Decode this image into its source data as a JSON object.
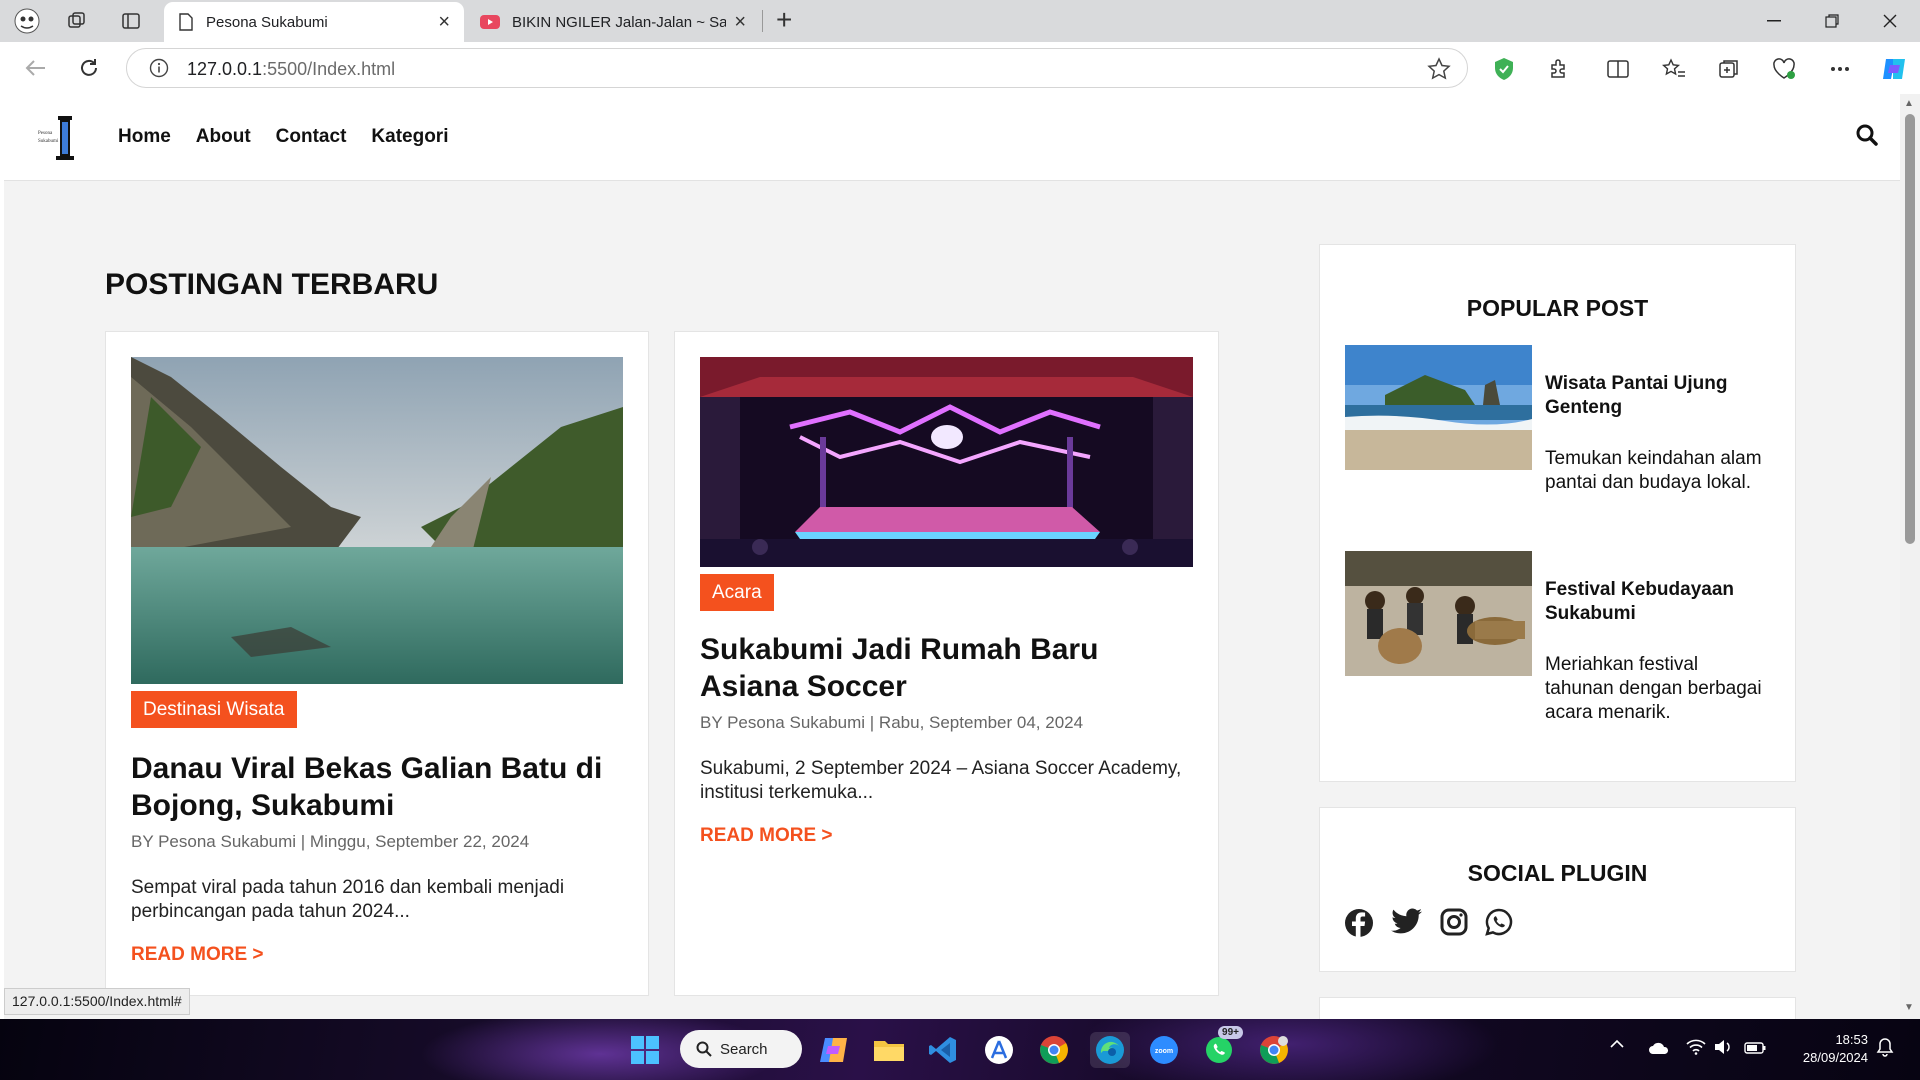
{
  "browser": {
    "tabs": [
      {
        "title": "Pesona Sukabumi",
        "active": true
      },
      {
        "title": "BIKIN NGILER Jalan-Jalan ~ Satu Ha",
        "active": false
      }
    ],
    "url_host": "127.0.0.1",
    "url_path": ":5500/Index.html",
    "status_url": "127.0.0.1:5500/Index.html#"
  },
  "site": {
    "nav": [
      "Home",
      "About",
      "Contact",
      "Kategori"
    ],
    "section_title": "POSTINGAN TERBARU",
    "posts": [
      {
        "category": "Destinasi Wisata",
        "title": "Danau Viral Bekas Galian Batu di Bojong, Sukabumi",
        "meta": "BY Pesona Sukabumi | Minggu, September 22, 2024",
        "excerpt": "Sempat viral pada tahun 2016 dan kembali menjadi perbincangan pada tahun 2024...",
        "read_more": "READ MORE >"
      },
      {
        "category": "Acara",
        "title": "Sukabumi Jadi Rumah Baru Asiana Soccer",
        "meta": "BY Pesona Sukabumi | Rabu, September 04, 2024",
        "excerpt": "Sukabumi, 2 September 2024 – Asiana Soccer Academy, institusi terkemuka...",
        "read_more": "READ MORE >"
      }
    ],
    "popular": {
      "title": "POPULAR POST",
      "items": [
        {
          "title": "Wisata Pantai Ujung Genteng",
          "desc": "Temukan keindahan alam pantai dan budaya lokal."
        },
        {
          "title": "Festival Kebudayaan Sukabumi",
          "desc": "Meriahkan festival tahunan dengan berbagai acara menarik."
        }
      ]
    },
    "social": {
      "title": "SOCIAL PLUGIN",
      "icons": [
        "facebook-icon",
        "twitter-icon",
        "instagram-icon",
        "whatsapp-icon"
      ]
    },
    "accent_color": "#f4511e"
  },
  "taskbar": {
    "search_label": "Search",
    "whatsapp_badge": "99+",
    "time": "18:53",
    "date": "28/09/2024"
  }
}
